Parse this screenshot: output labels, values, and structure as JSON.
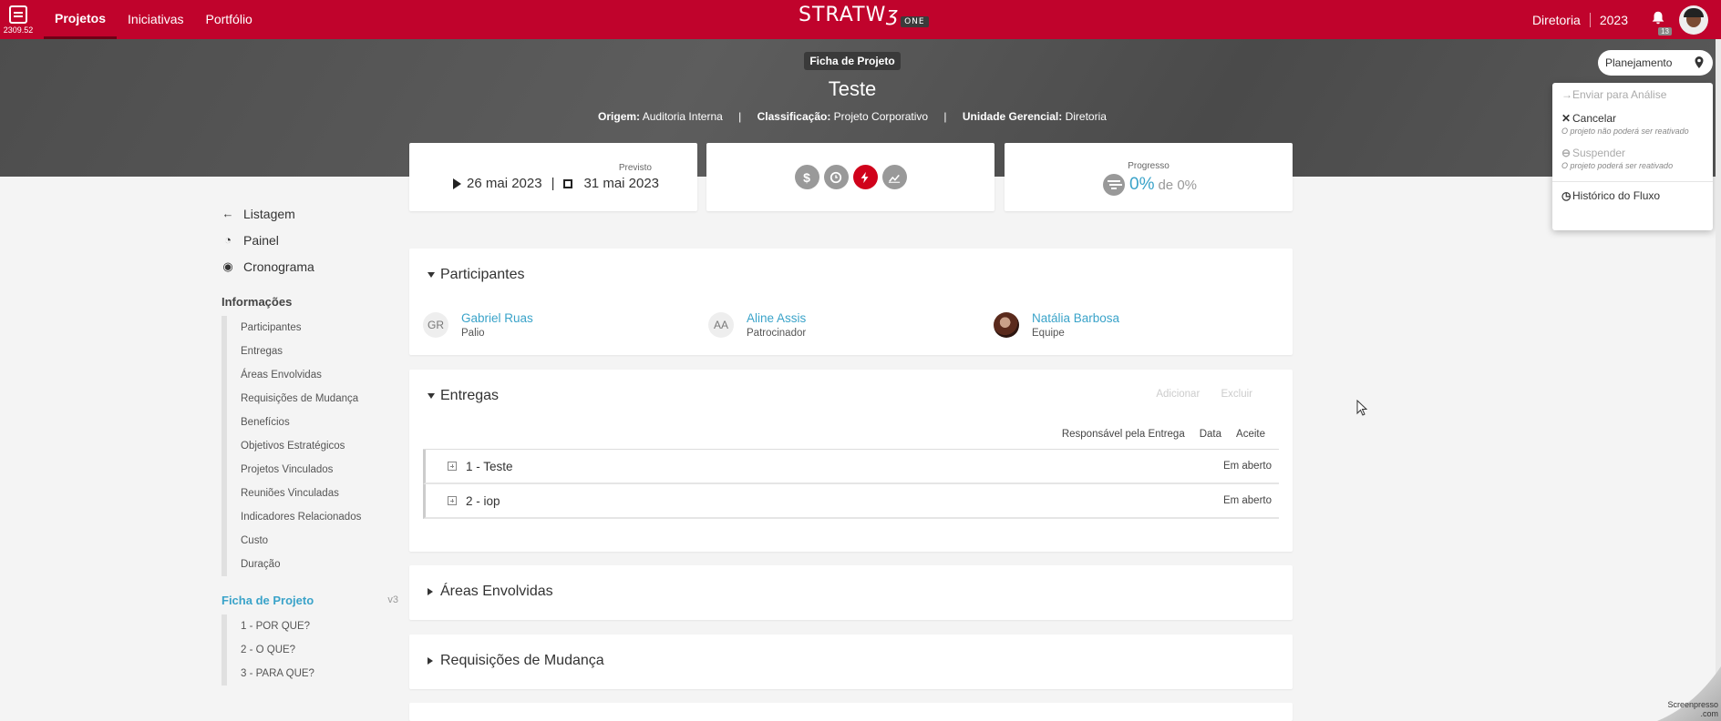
{
  "app": {
    "badge_number": "2309.52",
    "logo_text": "STRATW",
    "logo_suffix": "ONE"
  },
  "nav": [
    {
      "label": "Projetos",
      "active": true
    },
    {
      "label": "Iniciativas",
      "active": false
    },
    {
      "label": "Portfólio",
      "active": false
    }
  ],
  "topright": {
    "unit": "Diretoria",
    "year": "2023",
    "notif_count": "13"
  },
  "header": {
    "ficha_label": "Ficha de Projeto",
    "project_title": "Teste",
    "origem_label": "Origem:",
    "origem_value": "Auditoria Interna",
    "classificacao_label": "Classificação:",
    "classificacao_value": "Projeto Corporativo",
    "unidade_label": "Unidade Gerencial:",
    "unidade_value": "Diretoria"
  },
  "status": {
    "current": "Planejamento",
    "menu": {
      "enviar": "Enviar para Análise",
      "cancelar": "Cancelar",
      "cancelar_sub": "O projeto não poderá ser reativado",
      "suspender": "Suspender",
      "suspender_sub": "O projeto poderá ser reativado",
      "historico": "Histórico do Fluxo"
    }
  },
  "cards": {
    "dates_label": "Previsto",
    "start": "26 mai 2023",
    "end": "31 mai 2023",
    "progress_label": "Progresso",
    "progress_value": "0%",
    "progress_of": "de 0%",
    "progress_fraction": 0,
    "icon_dollar": "$",
    "icons": [
      "dollar-icon",
      "clock-icon",
      "bolt-icon",
      "chart-icon"
    ]
  },
  "sidebar": {
    "links": [
      {
        "label": "Listagem",
        "icon": "arrow-left-icon"
      },
      {
        "label": "Painel",
        "icon": "dashboard-icon"
      },
      {
        "label": "Cronograma",
        "icon": "calendar-icon"
      }
    ],
    "info_heading": "Informações",
    "info_items": [
      "Participantes",
      "Entregas",
      "Áreas Envolvidas",
      "Requisições de Mudança",
      "Benefícios",
      "Objetivos Estratégicos",
      "Projetos Vinculados",
      "Reuniões Vinculadas",
      "Indicadores Relacionados",
      "Custo",
      "Duração"
    ],
    "ficha_heading": "Ficha de Projeto",
    "ficha_version": "v3",
    "ficha_items": [
      "1 - POR QUE?",
      "2 - O QUE?",
      "3 - PARA QUE?"
    ]
  },
  "participants": {
    "title": "Participantes",
    "people": [
      {
        "initials": "GR",
        "name": "Gabriel Ruas",
        "role": "Palio"
      },
      {
        "initials": "AA",
        "name": "Aline Assis",
        "role": "Patrocinador"
      },
      {
        "initials": "",
        "name": "Natália Barbosa",
        "role": "Equipe"
      }
    ]
  },
  "entregas": {
    "title": "Entregas",
    "add_label": "Adicionar",
    "delete_label": "Excluir",
    "columns": [
      "Responsável pela Entrega",
      "Data",
      "Aceite"
    ],
    "rows": [
      {
        "name": "1 - Teste",
        "status": "Em aberto"
      },
      {
        "name": "2 - iop",
        "status": "Em aberto"
      }
    ]
  },
  "areas": {
    "title": "Áreas Envolvidas"
  },
  "requisicoes": {
    "title": "Requisições de Mudança"
  },
  "watermark": {
    "line1": "Screenpresso",
    "line2": ".com"
  },
  "colors": {
    "brand": "#c0032c",
    "link": "#3aa3c9",
    "danger": "#d0021b"
  }
}
